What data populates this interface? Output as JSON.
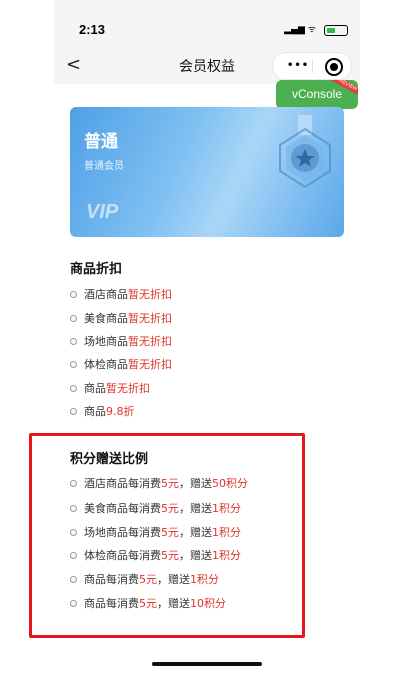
{
  "status_bar": {
    "time": "2:13",
    "signal": "..ıl"
  },
  "nav": {
    "back": "<",
    "title": "会员权益",
    "dots": "•••"
  },
  "vconsole": {
    "label": "vConsole",
    "ribbon": "REVIEW"
  },
  "card": {
    "level": "普通",
    "subtitle": "普通会员",
    "vip": "VIP"
  },
  "discount": {
    "title": "商品折扣",
    "items": [
      {
        "name": "酒店商品",
        "value": "暂无折扣"
      },
      {
        "name": "美食商品",
        "value": "暂无折扣"
      },
      {
        "name": "场地商品",
        "value": "暂无折扣"
      },
      {
        "name": "体检商品",
        "value": "暂无折扣"
      },
      {
        "name": "商品",
        "value": "暂无折扣"
      },
      {
        "name": "商品",
        "value": "9.8折"
      }
    ]
  },
  "points": {
    "title": "积分赠送比例",
    "items": [
      {
        "name": "酒店商品每消费",
        "amount": "5元",
        "mid": "，赠送",
        "points": "50积分"
      },
      {
        "name": "美食商品每消费",
        "amount": "5元",
        "mid": "，赠送",
        "points": "1积分"
      },
      {
        "name": "场地商品每消费",
        "amount": "5元",
        "mid": "，赠送",
        "points": "1积分"
      },
      {
        "name": "体检商品每消费",
        "amount": "5元",
        "mid": "，赠送",
        "points": "1积分"
      },
      {
        "name": "商品每消费",
        "amount": "5元",
        "mid": "，赠送",
        "points": "1积分"
      },
      {
        "name": "商品每消费",
        "amount": "5元",
        "mid": "，赠送",
        "points": "10积分"
      }
    ]
  },
  "colors": {
    "accent": "#e0342a",
    "card": "#5aa7ea",
    "highlight": "#e8141b",
    "vconsole": "#4caf50"
  }
}
